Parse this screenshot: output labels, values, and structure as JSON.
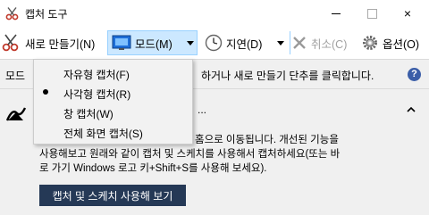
{
  "window": {
    "title": "캡처 도구",
    "controls": {
      "minimize": "minimize",
      "maximize": "maximize",
      "close": "×"
    }
  },
  "toolbar": {
    "new_label": "새로 만들기(N)",
    "mode_label": "모드(M)",
    "delay_label": "지연(D)",
    "cancel_label": "취소(C)",
    "options_label": "옵션(O)"
  },
  "infobar": {
    "left_text": "모드",
    "right_text": "하거나 새로 만들기 단추를 클릭합니다."
  },
  "notice": {
    "dots": "...",
    "lines": [
      "홈으로 이동됩니다. 개선된 기능을",
      "사용해보고 원래와 같이 캡처 및 스케치를 사용해서 캡처하세요(또는 바",
      "로 가기 Windows 로고 키+Shift+S를 사용해 보세요)."
    ],
    "button_label": "캡처 및 스케치 사용해 보기"
  },
  "mode_menu": {
    "items": [
      {
        "label": "자유형 캡처(F)",
        "selected": false
      },
      {
        "label": "사각형 캡처(R)",
        "selected": true
      },
      {
        "label": "창 캡처(W)",
        "selected": false
      },
      {
        "label": "전체 화면 캡처(S)",
        "selected": false
      }
    ]
  },
  "colors": {
    "accent_highlight": "#cce8ff",
    "button_dark": "#253956",
    "help_icon": "#3b5ea8"
  }
}
